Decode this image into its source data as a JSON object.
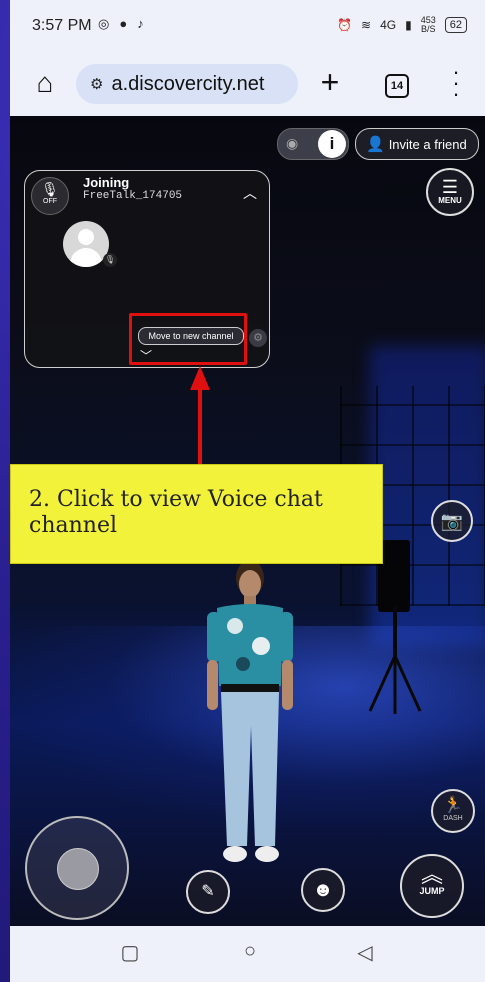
{
  "status_bar": {
    "time": "3:57 PM",
    "left_icons": [
      "instagram-icon",
      "messenger-icon",
      "mic-icon"
    ],
    "right_icons": [
      "alarm-icon",
      "wifi-icon",
      "signal-icon"
    ],
    "network": "4G",
    "data_rate": "453",
    "data_unit": "B/S",
    "battery": "62"
  },
  "browser": {
    "url": "a.discovercity.net",
    "tab_count": "14"
  },
  "game": {
    "invite_label": "Invite a friend",
    "menu_label": "MENU",
    "dash_label": "DASH",
    "jump_label": "JUMP",
    "voice_panel": {
      "mic_label": "OFF",
      "status": "Joining",
      "channel": "FreeTalk_174705",
      "move_button": "Move to new channel"
    }
  },
  "callout": {
    "text": "2. Click to view Voice chat channel",
    "highlight_color": "#e01010",
    "background_color": "#f2f23a"
  }
}
